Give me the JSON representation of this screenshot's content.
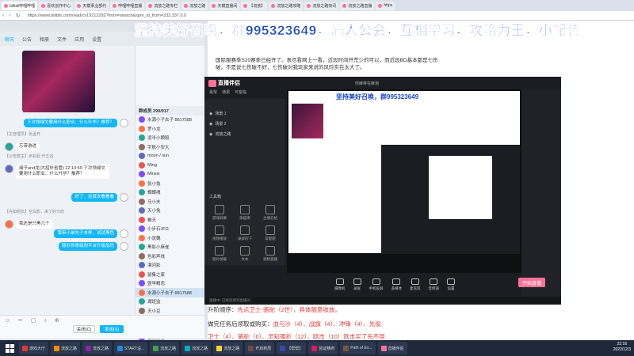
{
  "browser": {
    "tabs": [
      "bilibili哔哩哔哩",
      "喜欢创作中心",
      "天模事业部约",
      "哔哩哔哩直播",
      "流放之路专栏",
      "流放之路",
      "天模直播间",
      "【流放】",
      "流放之路攻略",
      "流放之路快讯",
      "流放之路直播",
      "https"
    ],
    "url": "https://www.bilibili.com/read/cv19212292?from=search&spm_id_from=333.337.0.0"
  },
  "overlay_banner": {
    "part1": "坚持美好召唤，群",
    "group_number": "995323649",
    "part2": "，满人公会，",
    "highlight": "互相学习",
    "part3": "，攻略为王，小配装"
  },
  "article": {
    "intro": "国际服赛季S20赛季已经开了。表尽看网上一看，近段时间开荒少的可以，而近段BD基本都是七伤破。不是说七伤破不好，七伤破对我玩家来说的风险实在太大了。",
    "line_a_label": "升阶顺序：",
    "line_a_value": "先点卫士-骆驼（2世），具体随意收放。",
    "line_b_label": "做完任务后领取或购买：",
    "line_b_value": "血与沙（4）、战旗（4）、冲锋（4）、先役",
    "line_c": "卫士（4）、骆驼（6）、灵知强折（12）、跃击（10）跃击买了先不用"
  },
  "qq": {
    "tabs": [
      "聊天",
      "公告",
      "相册",
      "文件",
      "应用",
      "设置"
    ],
    "messages": [
      {
        "text": "下次领绿欠要用什么职业、什么升华？推荐？",
        "me": true
      },
      {
        "text": "【主管理员】张孟开",
        "me": false,
        "sys": true
      },
      {
        "text": "忘带游进",
        "me": false
      },
      {
        "text": "【公告群主】步彩起 开王名",
        "me": false,
        "sys": true
      },
      {
        "text": "澜子and龙(大招外省管) 22:10:59 下次领绿欠要用什么职业、什么升华？推荐？",
        "me": false
      },
      {
        "text": "好了，这就去看看看",
        "me": true
      },
      {
        "text": "【先知组长】空白影，来了好元的",
        "me": false,
        "sys": true
      },
      {
        "text": "我还是只黑几个",
        "me": false
      },
      {
        "text": "我带小弟先子去样，试试黑色",
        "me": true
      },
      {
        "text": "隐形传奇级别平台升级加历",
        "me": true
      }
    ],
    "members_header": "群成员 299/917",
    "members": [
      "水源小子去子 8817588",
      "罗小龙",
      "凌半小颗股",
      "宇航小安大",
      "moon / sun",
      "Ming",
      "Minsix",
      "张小兔",
      "蝶蝶魂",
      "马小夫",
      "天小兔",
      "帷天",
      "小步石JFG",
      "小流魏",
      "黑影小麻雀",
      "色彩声线",
      "漠河影",
      "鼠集之家",
      "暨学精忠",
      "水源小子去子 8817588",
      "湖班监",
      "天小豆",
      "小水子",
      "天宇",
      "快乐天心",
      "平平小鼠"
    ],
    "close_label": "关闭(C)",
    "send_label": "发送(S)"
  },
  "app": {
    "brand": "直播伴侣",
    "menu": [
      "最常",
      "通报",
      "可客临"
    ],
    "room_title": "你麻徘在麻泡",
    "scenes": [
      "场景 1",
      "场景 2",
      "流放之路"
    ],
    "tools_header": "工具箱",
    "tools": [
      "游戏屏幕",
      "歌超库",
      "主播云给",
      "视频播放",
      "录屏的下",
      "常麽题",
      "图片加载",
      "文本",
      "视频直播"
    ],
    "controls": [
      "摄像机",
      "录屏",
      "手机投屏",
      "多媒体",
      "麦克风",
      "音频道",
      "设置"
    ],
    "live_label": "开始直播",
    "status": "直播中: 已经连接到直播间"
  },
  "taskbar": {
    "items": [
      "游戏大厅",
      "流放之路",
      "流放之路",
      "START设...",
      "流放之路",
      "流放之路",
      "流放之路",
      "开启新层",
      "【帮帮】",
      "验证精府",
      "Path of Ex...",
      "直播伴侣"
    ],
    "time": "22:16",
    "date": "2022/12/3"
  },
  "colors": {
    "bilibili_pink": "#fb7299",
    "qq_blue": "#12b7f5",
    "overlay_blue": "#1846c8"
  }
}
